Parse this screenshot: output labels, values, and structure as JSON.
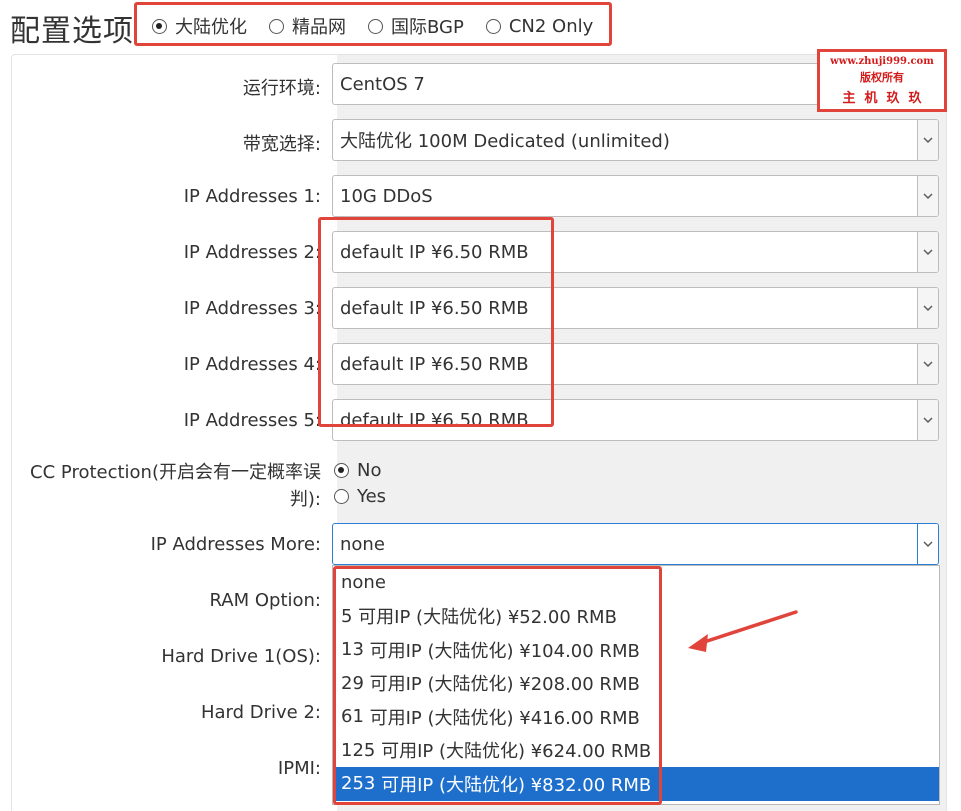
{
  "header": {
    "title": "配置选项",
    "region_options": [
      {
        "label": "大陆优化",
        "checked": true
      },
      {
        "label": "精品网",
        "checked": false
      },
      {
        "label": "国际BGP",
        "checked": false
      },
      {
        "label": "CN2 Only",
        "checked": false
      }
    ]
  },
  "fields": {
    "os": {
      "label": "运行环境:",
      "value": "CentOS 7"
    },
    "bandwidth": {
      "label": "带宽选择:",
      "value": "大陆优化 100M Dedicated (unlimited)"
    },
    "ip1": {
      "label": "IP Addresses 1:",
      "value": "10G DDoS"
    },
    "ip2": {
      "label": "IP Addresses 2:",
      "value": "default IP ¥6.50 RMB"
    },
    "ip3": {
      "label": "IP Addresses 3:",
      "value": "default IP ¥6.50 RMB"
    },
    "ip4": {
      "label": "IP Addresses 4:",
      "value": "default IP ¥6.50 RMB"
    },
    "ip5": {
      "label": "IP Addresses 5:",
      "value": "default IP ¥6.50 RMB"
    },
    "cc": {
      "label_line1": "CC Protection(开启会有一定概率误",
      "label_line2": "判):",
      "options": [
        "No",
        "Yes"
      ],
      "selected": "No"
    },
    "ip_more": {
      "label": "IP Addresses More:",
      "value": "none"
    },
    "ram": {
      "label": "RAM Option:"
    },
    "hd1": {
      "label": "Hard Drive 1(OS):"
    },
    "hd2": {
      "label": "Hard Drive 2:"
    },
    "ipmi": {
      "label": "IPMI:"
    }
  },
  "dropdown": {
    "items": [
      {
        "count": "none",
        "text": ""
      },
      {
        "count": "5",
        "text": " 可用IP (大陆优化) ¥52.00 RMB"
      },
      {
        "count": "13",
        "text": " 可用IP (大陆优化) ¥104.00 RMB"
      },
      {
        "count": "29",
        "text": " 可用IP (大陆优化) ¥208.00 RMB"
      },
      {
        "count": "61",
        "text": " 可用IP (大陆优化) ¥416.00 RMB"
      },
      {
        "count": "125",
        "text": " 可用IP (大陆优化) ¥624.00 RMB"
      },
      {
        "count": "253",
        "text": " 可用IP (大陆优化) ¥832.00 RMB"
      }
    ],
    "selected_index": 6
  },
  "watermark": {
    "line1": "www.zhuji999.com",
    "line2": "版权所有",
    "line3": "主机玖玖"
  },
  "colors": {
    "highlight": "#e0443b",
    "selected_bg": "#1e6fcc",
    "focus_border": "#2a7fd4"
  }
}
